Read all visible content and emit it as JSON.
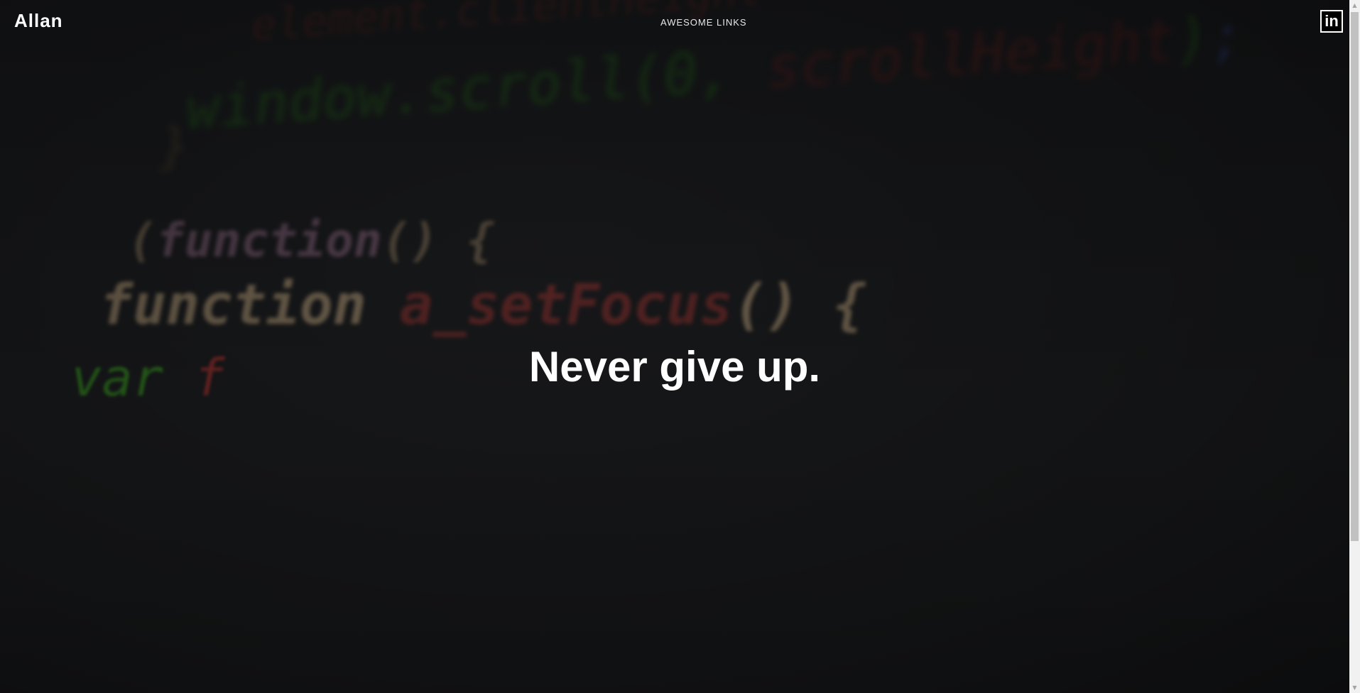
{
  "header": {
    "brand": "Allan",
    "nav_link": "AWESOME LINKS",
    "social_icon": "linkedin-icon",
    "social_label": "in"
  },
  "hero": {
    "headline": "Never give up.",
    "background_icon": "code-background-image"
  },
  "scrollbar": {
    "up_glyph": "▲",
    "down_glyph": "▼"
  },
  "colors": {
    "background": "#141517",
    "text": "#ffffff",
    "scrollbar_track": "#f1f1f1",
    "scrollbar_thumb": "#c1c1c1"
  }
}
